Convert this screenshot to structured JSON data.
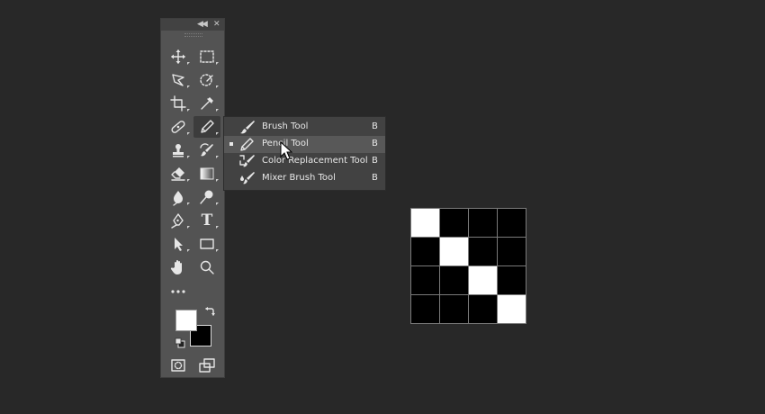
{
  "tools_panel": {
    "header": {
      "collapse_icon": "double-chevron-left",
      "close_icon": "close-x"
    },
    "tools": [
      {
        "id": "move",
        "icon": "move-icon"
      },
      {
        "id": "marquee",
        "icon": "rectangular-marquee-icon"
      },
      {
        "id": "lasso",
        "icon": "polygonal-lasso-icon"
      },
      {
        "id": "quick-select",
        "icon": "quick-selection-icon"
      },
      {
        "id": "crop",
        "icon": "crop-icon"
      },
      {
        "id": "eyedropper",
        "icon": "eyedropper-icon"
      },
      {
        "id": "healing",
        "icon": "healing-brush-icon"
      },
      {
        "id": "pencil",
        "icon": "pencil-icon",
        "active": true
      },
      {
        "id": "stamp",
        "icon": "clone-stamp-icon"
      },
      {
        "id": "history-brush",
        "icon": "history-brush-icon"
      },
      {
        "id": "eraser",
        "icon": "eraser-icon"
      },
      {
        "id": "gradient",
        "icon": "gradient-icon"
      },
      {
        "id": "blur",
        "icon": "blur-icon"
      },
      {
        "id": "dodge",
        "icon": "dodge-icon"
      },
      {
        "id": "pen",
        "icon": "pen-icon"
      },
      {
        "id": "type",
        "icon": "type-icon"
      },
      {
        "id": "path-select",
        "icon": "path-selection-icon"
      },
      {
        "id": "shape",
        "icon": "rectangle-shape-icon"
      },
      {
        "id": "hand",
        "icon": "hand-icon"
      },
      {
        "id": "zoom",
        "icon": "zoom-icon"
      },
      {
        "id": "more",
        "icon": "more-icon"
      },
      {
        "id": "quick-mask",
        "icon": "quick-mask-icon"
      },
      {
        "id": "screen-mode",
        "icon": "screen-mode-icon"
      }
    ],
    "type_tool_glyph": "T",
    "colors": {
      "foreground": "#ffffff",
      "background": "#000000"
    }
  },
  "flyout_menu": {
    "items": [
      {
        "label": "Brush Tool",
        "shortcut": "B",
        "icon": "brush-icon",
        "selected": false
      },
      {
        "label": "Pencil Tool",
        "shortcut": "B",
        "icon": "pencil-icon",
        "selected": true
      },
      {
        "label": "Color Replacement Tool",
        "shortcut": "B",
        "icon": "color-replacement-icon",
        "selected": false
      },
      {
        "label": "Mixer Brush Tool",
        "shortcut": "B",
        "icon": "mixer-brush-icon",
        "selected": false
      }
    ]
  },
  "canvas": {
    "pixel_grid": {
      "rows": 4,
      "cols": 4,
      "cells": [
        [
          1,
          0,
          0,
          0
        ],
        [
          0,
          1,
          0,
          0
        ],
        [
          0,
          0,
          1,
          0
        ],
        [
          0,
          0,
          0,
          1
        ]
      ],
      "on_color": "#ffffff",
      "off_color": "#000000"
    }
  }
}
